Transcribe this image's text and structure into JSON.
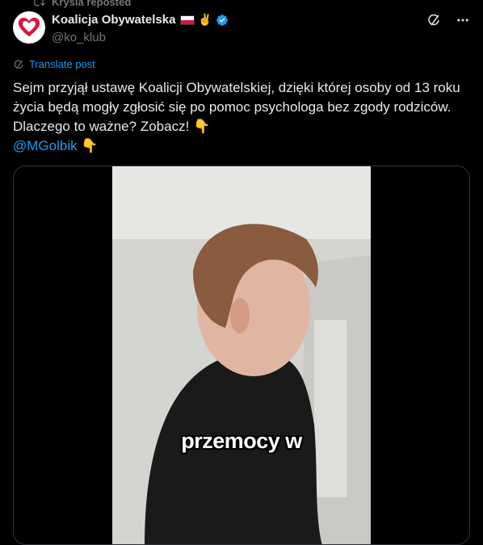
{
  "repost": {
    "text": "Krysia reposted",
    "icon": "repost-icon"
  },
  "author": {
    "name": "Koalicja Obywatelska",
    "handle": "@ko_klub",
    "flag": "poland-flag-icon",
    "hand": "✌️",
    "verified": "verified-badge-icon",
    "accent_color": "#dc143c"
  },
  "actions": {
    "grok_icon": "grok-icon",
    "more_icon": "more-icon"
  },
  "translate": {
    "label": "Translate post",
    "icon": "globe-icon",
    "color": "#1d9bf0"
  },
  "post": {
    "text": "Sejm przyjął ustawę Koalicji Obywatelskiej, dzięki której osoby od 13 roku życia będą mogły zgłosić się po pomoc psychologa bez zgody rodziców. Dlaczego to ważne? Zobacz! 👇",
    "mention": "@MGolbik",
    "mention_emoji": "👇",
    "link_color": "#1d9bf0"
  },
  "media": {
    "caption": "przemocy w"
  }
}
